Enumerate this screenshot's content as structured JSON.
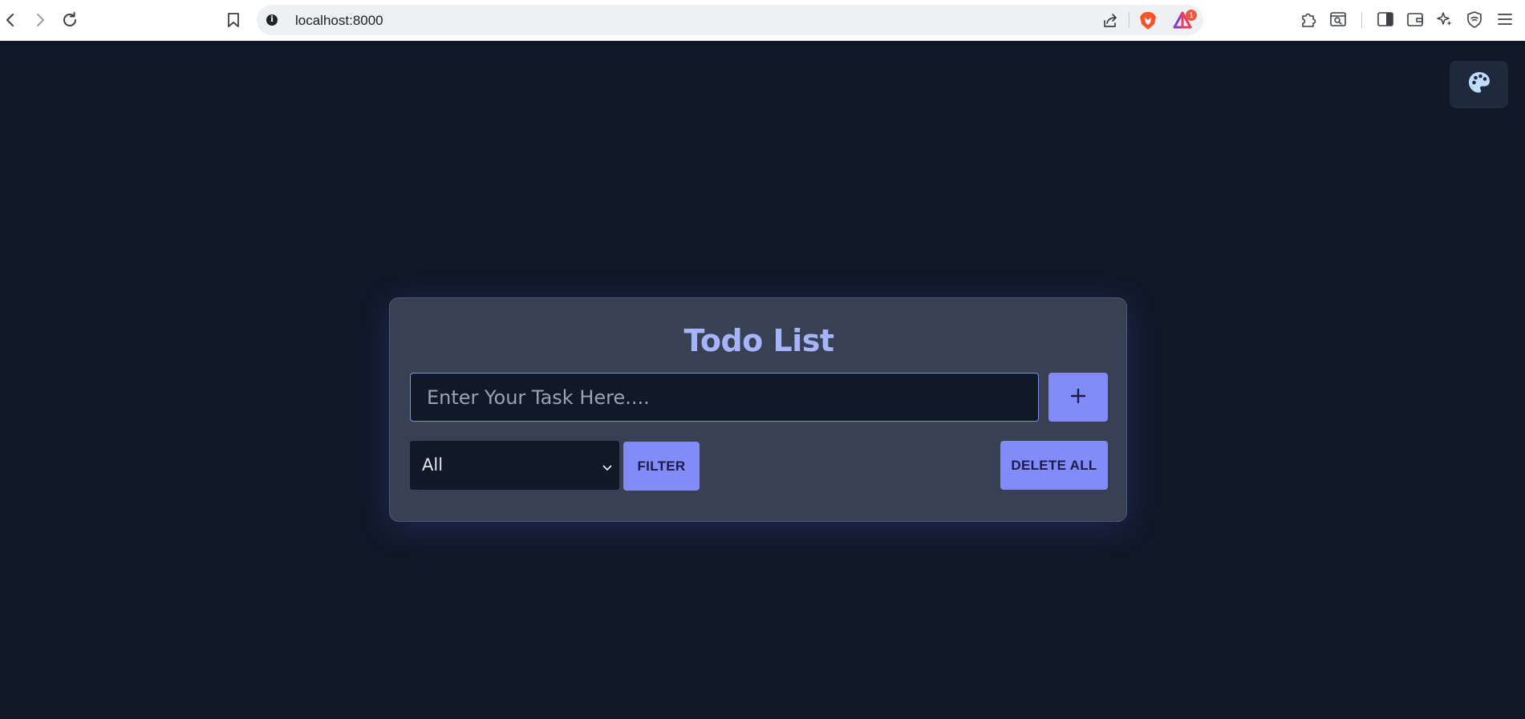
{
  "browser": {
    "url": "localhost:8000",
    "rewards_badge_count": "1",
    "icons": [
      "back-icon",
      "forward-icon",
      "reload-icon",
      "bookmark-icon",
      "site-info-icon",
      "share-icon",
      "brave-shields-icon",
      "brave-rewards-icon",
      "extensions-icon",
      "tab-search-icon",
      "sidebar-icon",
      "wallet-icon",
      "leo-ai-icon",
      "vpn-icon",
      "menu-icon"
    ]
  },
  "page": {
    "background_color": "#111827",
    "theme_button_icon": "palette-icon"
  },
  "todo": {
    "title": "Todo List",
    "input_placeholder": "Enter Your Task Here....",
    "input_value": "",
    "add_button_icon": "plus-icon",
    "filter_selected": "All",
    "filter_label": "FILTER",
    "delete_all_label": "DELETE ALL",
    "accent_color": "#818cf8",
    "card_color": "#374151"
  }
}
